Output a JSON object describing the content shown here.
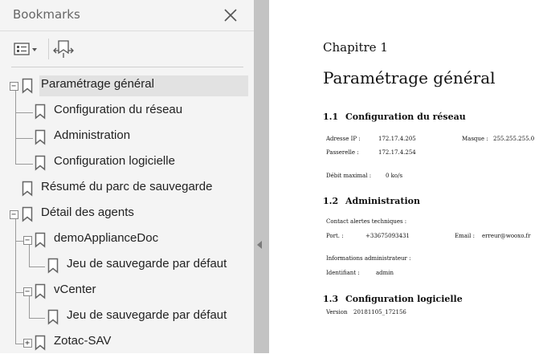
{
  "sidebar": {
    "title": "Bookmarks",
    "toolbar": {
      "options_icon": "options-list-icon",
      "expand_icon": "expand-bookmark-icon"
    }
  },
  "tree": [
    {
      "label": "Paramétrage général",
      "expanded": true,
      "selected": true
    },
    {
      "label": "Configuration du réseau"
    },
    {
      "label": "Administration"
    },
    {
      "label": "Configuration logicielle"
    },
    {
      "label": "Résumé du parc de sauvegarde"
    },
    {
      "label": "Détail des agents",
      "expanded": true
    },
    {
      "label": "demoApplianceDoc",
      "expanded": true
    },
    {
      "label": "Jeu de sauvegarde par défaut"
    },
    {
      "label": "vCenter",
      "expanded": true
    },
    {
      "label": "Jeu de sauvegarde par défaut"
    },
    {
      "label": "Zotac-SAV",
      "expanded": false
    }
  ],
  "document": {
    "chapter": "Chapitre 1",
    "title": "Paramétrage général",
    "sections": [
      {
        "number": "1.1",
        "title": "Configuration du réseau",
        "ip_label": "Adresse IP :",
        "ip_value": "172.17.4.205",
        "mask_label": "Masque :",
        "mask_value": "255.255.255.0",
        "gateway_label": "Passerelle :",
        "gateway_value": "172.17.4.254",
        "rate_label": "Débit maximal :",
        "rate_value": "0 ko/s"
      },
      {
        "number": "1.2",
        "title": "Administration",
        "contact_heading": "Contact alertes techniques :",
        "port_label": "Port. :",
        "port_value": "+33675093431",
        "email_label": "Email :",
        "email_value": "erreur@wooxo.fr",
        "admin_heading": "Informations administrateur :",
        "id_label": "Identifiant :",
        "id_value": "admin"
      },
      {
        "number": "1.3",
        "title": "Configuration logicielle",
        "version_label": "Version",
        "version_value": "20181105_172156"
      }
    ]
  }
}
